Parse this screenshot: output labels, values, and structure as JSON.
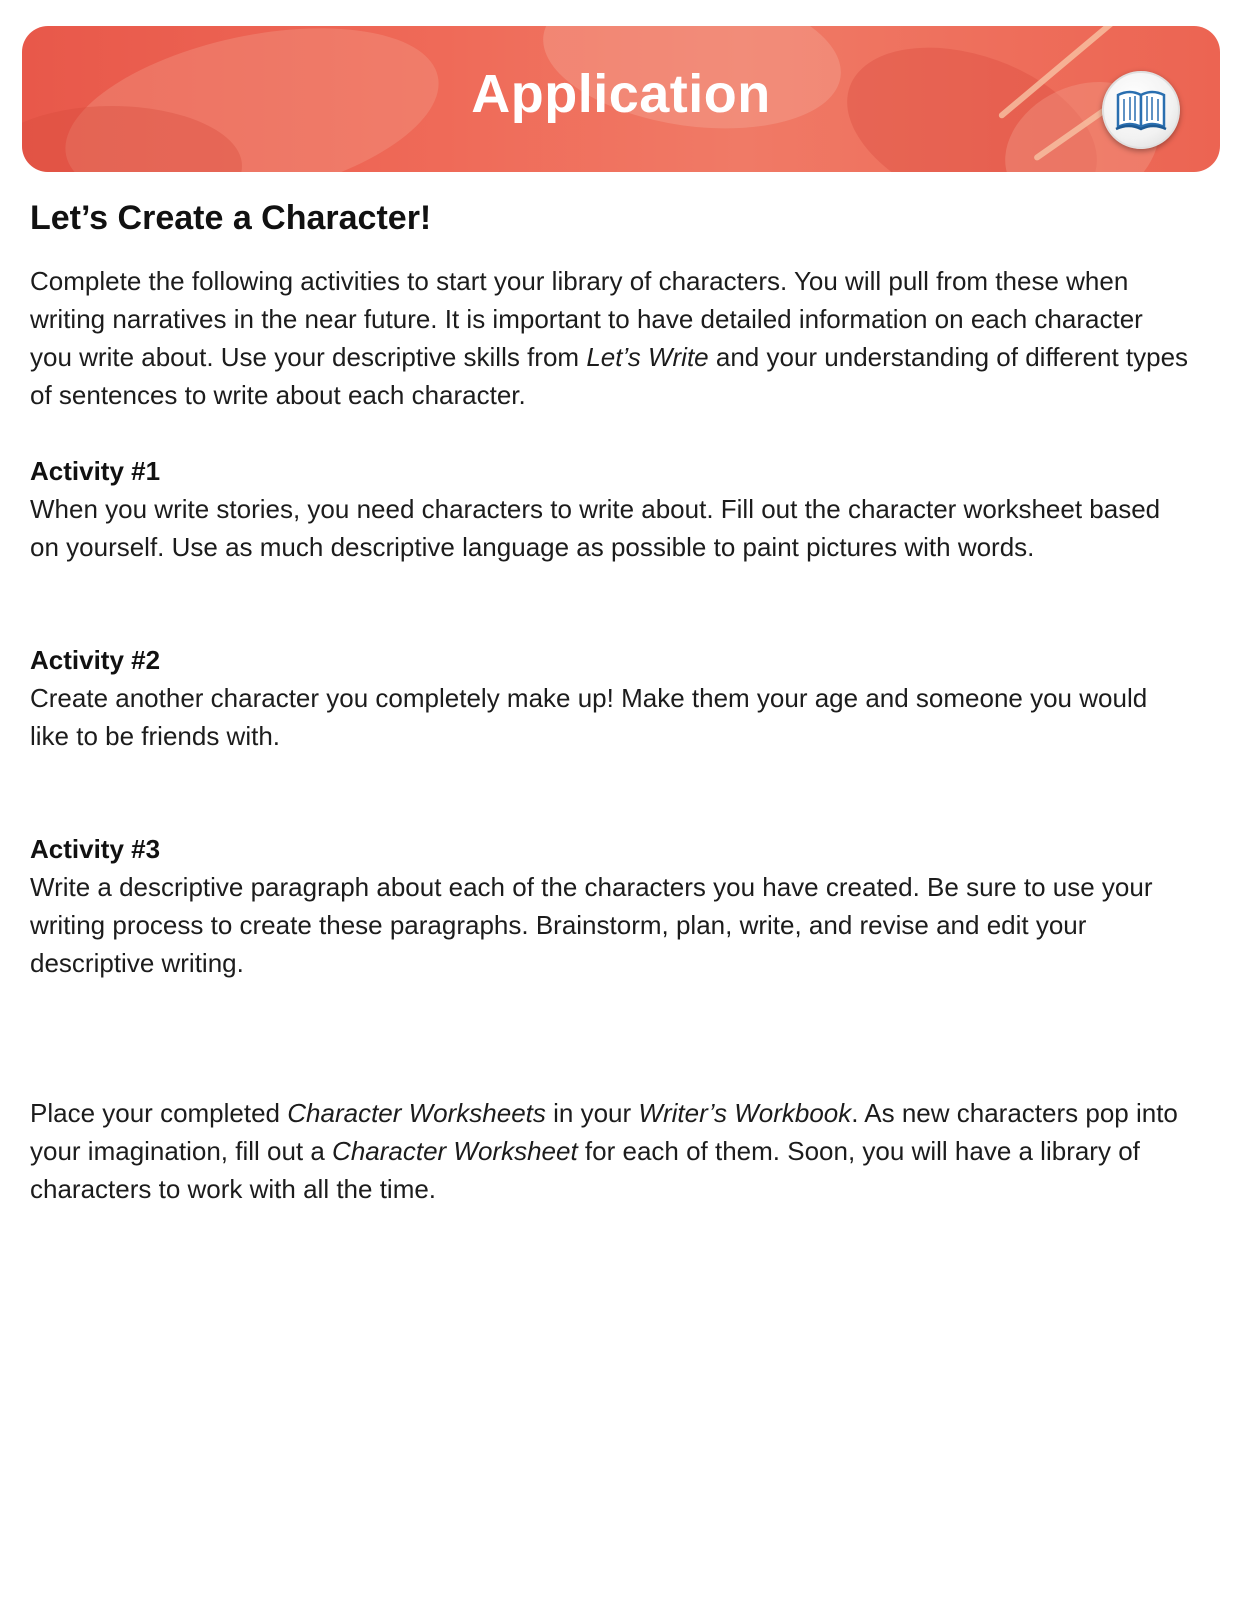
{
  "banner": {
    "title": "Application",
    "icon": "open-book-icon",
    "color": "#ec6452"
  },
  "page_title": "Let’s Create a Character!",
  "intro": {
    "part1": "Complete the following activities to start your library of characters. You will pull from these when writing narratives in the near future. It is important to have detailed information on each character you write about. Use your descriptive skills from ",
    "italic1": "Let’s Write",
    "part2": " and your understanding of different types of sentences to write about each character."
  },
  "activities": [
    {
      "heading": "Activity #1",
      "text": "When you write stories, you need characters to write about. Fill out the character worksheet based on yourself. Use as much descriptive language as possible to paint pictures with words."
    },
    {
      "heading": "Activity #2",
      "text": "Create another character you completely make up! Make them your age and someone you would like to be friends with."
    },
    {
      "heading": "Activity #3",
      "text": "Write a descriptive paragraph about each of the characters you have created. Be sure to use your writing process to create these paragraphs. Brainstorm, plan, write, and revise and edit your descriptive writing."
    }
  ],
  "closing": {
    "part1": "Place your completed ",
    "italic1": "Character Worksheets",
    "part2": " in your ",
    "italic2": "Writer’s Workbook",
    "part3": ". As new characters pop into your imagination, fill out a ",
    "italic3": "Character Worksheet",
    "part4": " for each of them. Soon, you will have a library of characters to work with all the time."
  }
}
